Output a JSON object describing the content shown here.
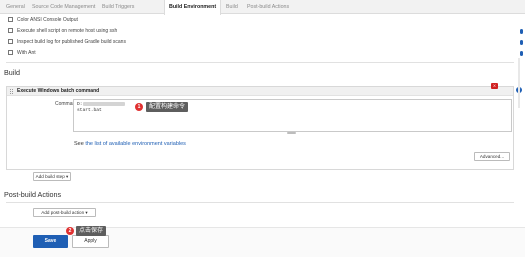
{
  "tabs": [
    "General",
    "Source Code Management",
    "Build Triggers",
    "Build Environment",
    "Build",
    "Post-build Actions"
  ],
  "build_environment": {
    "options": [
      "Color ANSI Console Output",
      "Execute shell script on remote host using ssh",
      "Inspect build log for published Gradle build scans",
      "With Ant"
    ]
  },
  "build": {
    "section_title": "Build",
    "step_title": "Execute Windows batch command",
    "delete_label": "X",
    "help_label": "?",
    "command_label": "Command",
    "command_lines": [
      "D:",
      "start.bat"
    ],
    "env_text_prefix": "See ",
    "env_link": "the list of available environment variables",
    "advanced_button": "Advanced...",
    "add_build_step_button": "Add build step ▾"
  },
  "post_build": {
    "section_title": "Post-build Actions",
    "add_post_build_button": "Add post-build action ▾"
  },
  "annotations": [
    {
      "number": "1",
      "text": "配置构建命令"
    },
    {
      "number": "2",
      "text": "点击保存"
    }
  ],
  "actions": {
    "save": "Save",
    "apply": "Apply"
  },
  "colors": {
    "primary": "#1f5fb4",
    "badge": "#e03131",
    "tooltip": "#5e5e5e"
  }
}
